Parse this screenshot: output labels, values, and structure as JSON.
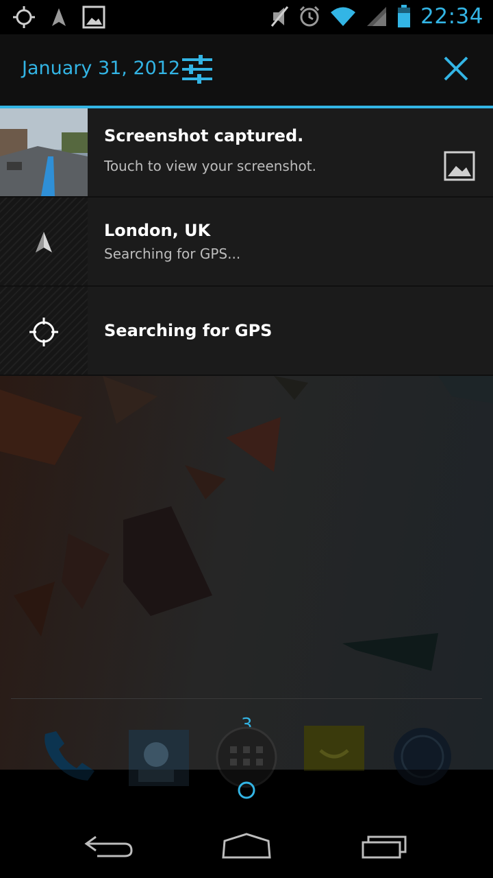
{
  "status_bar": {
    "time": "22:34",
    "icons": [
      "gps-target-icon",
      "navigation-arrow-icon",
      "gallery-icon",
      "mute-icon",
      "alarm-icon",
      "wifi-icon",
      "signal-icon",
      "battery-icon"
    ]
  },
  "header": {
    "date": "January 31, 2012"
  },
  "notifications": [
    {
      "title": "Screenshot captured.",
      "text": "Touch to view your screenshot.",
      "icon": "screenshot-thumbnail"
    },
    {
      "title": "London, UK",
      "text": "Searching for GPS...",
      "icon": "navigation-arrow-icon"
    },
    {
      "title": "Searching for GPS",
      "icon": "gps-target-icon"
    }
  ],
  "home": {
    "page_number": "3"
  },
  "colors": {
    "accent": "#33b5e5",
    "panel": "#1b1b1b"
  }
}
